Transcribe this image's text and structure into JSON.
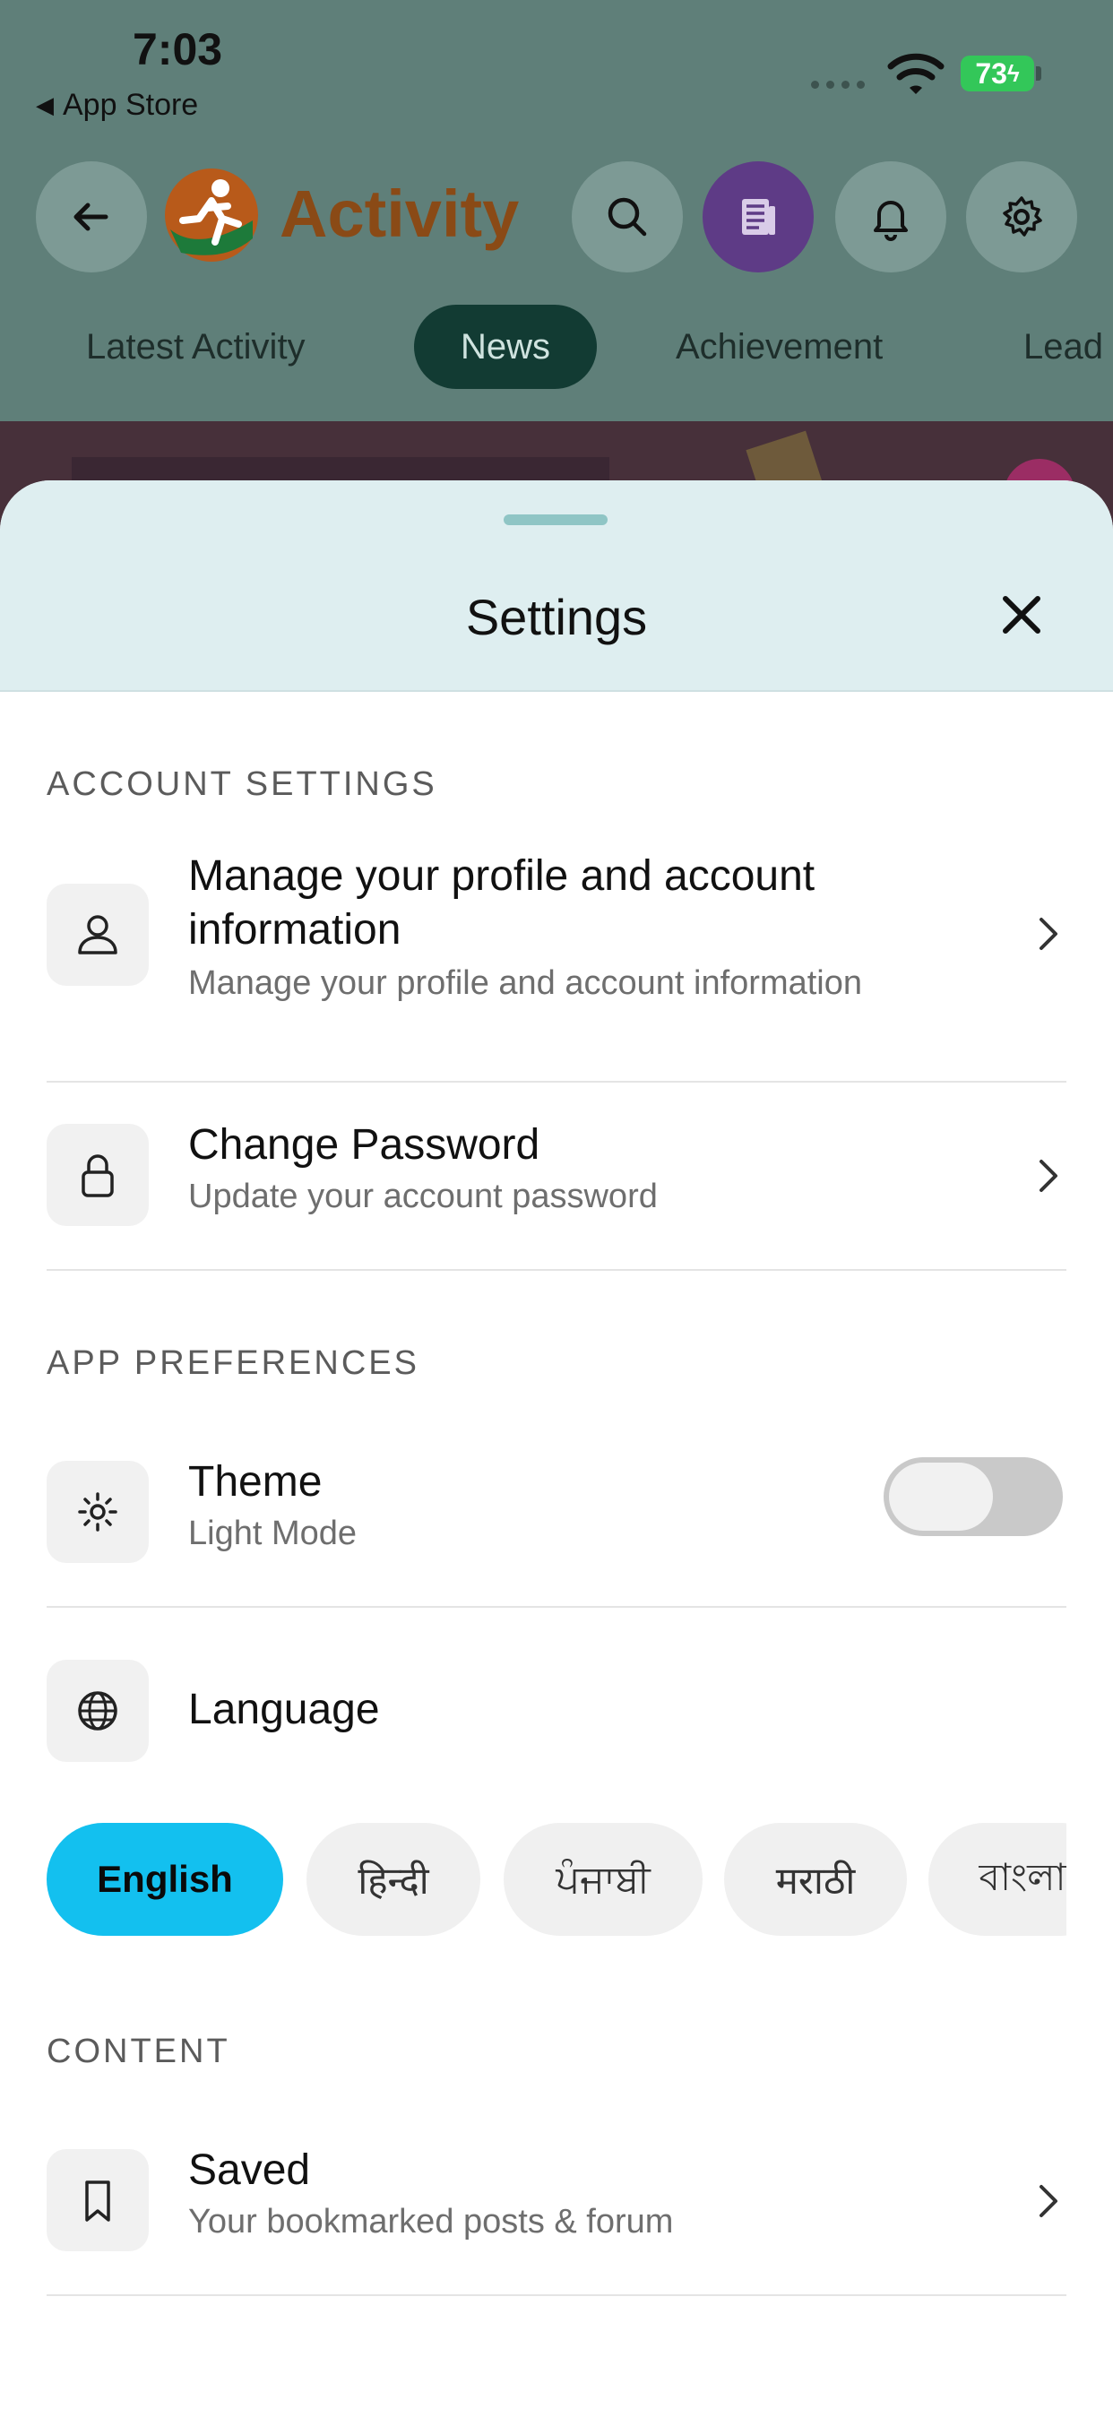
{
  "status_bar": {
    "time": "7:03",
    "back_label": "App Store",
    "battery": "73"
  },
  "header": {
    "app_title": "Activity",
    "icons": [
      "back-arrow-icon",
      "activity-runner-logo",
      "search-icon",
      "news-icon",
      "bell-icon",
      "gear-icon"
    ],
    "active_icon_color": "#5e3b86"
  },
  "tabs": [
    {
      "label": "Latest Activity",
      "active": false
    },
    {
      "label": "News",
      "active": true
    },
    {
      "label": "Achievement",
      "active": false
    },
    {
      "label": "Lead",
      "active": false
    }
  ],
  "sheet": {
    "title": "Settings",
    "close_icon": "close-icon",
    "sections": {
      "account": {
        "label": "ACCOUNT SETTINGS",
        "items": [
          {
            "title_line1": "Manage your profile and account",
            "title_line2": "information",
            "subtitle": "Manage your profile and account information",
            "icon": "user-icon"
          },
          {
            "title": "Change Password",
            "subtitle": "Update your account password",
            "icon": "lock-icon"
          }
        ]
      },
      "preferences": {
        "label": "APP PREFERENCES",
        "theme": {
          "title": "Theme",
          "subtitle": "Light Mode",
          "icon": "sun-icon",
          "toggle_on": false
        },
        "language": {
          "title": "Language",
          "icon": "globe-icon",
          "options": [
            "English",
            "हिन्दी",
            "ਪੰਜਾਬੀ",
            "मराठी",
            "বাংলা"
          ],
          "selected": "English"
        }
      },
      "content": {
        "label": "CONTENT",
        "items": [
          {
            "title": "Saved",
            "subtitle": "Your bookmarked posts & forum",
            "icon": "bookmark-icon"
          }
        ]
      }
    }
  },
  "colors": {
    "accent": "#13c0ef",
    "sheet_header_bg": "#deeef0",
    "app_title": "#8a4a16"
  }
}
